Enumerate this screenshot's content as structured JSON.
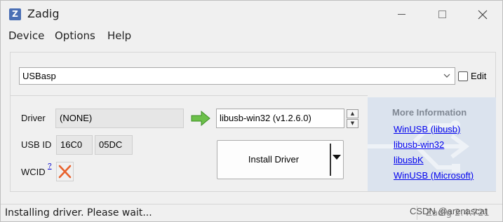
{
  "window": {
    "title": "Zadig",
    "icon": "zadig-app-icon",
    "icon_glyph": "Z"
  },
  "menu": {
    "items": [
      "Device",
      "Options",
      "Help"
    ]
  },
  "device": {
    "selected": "USBasp",
    "edit_label": "Edit",
    "edit_checked": false
  },
  "driver": {
    "label": "Driver",
    "current": "(NONE)",
    "target": "libusb-win32 (v1.2.6.0)",
    "arrow_color": "#5cb85c"
  },
  "usb_id": {
    "label": "USB ID",
    "vid": "16C0",
    "pid": "05DC"
  },
  "wcid": {
    "label": "WCID",
    "help_link": "?",
    "status_icon": "red-x-icon",
    "status_color": "#e8612c"
  },
  "install": {
    "label": "Install Driver"
  },
  "info": {
    "title": "More Information",
    "links": [
      "WinUSB (libusb)",
      "libusb-win32",
      "libusbK",
      "WinUSB (Microsoft)"
    ],
    "link_color": "#0000ee"
  },
  "status": {
    "text": "Installing driver. Please wait...",
    "version": "Zadig 2.4.721",
    "watermark": "CSDN @arenascat"
  }
}
